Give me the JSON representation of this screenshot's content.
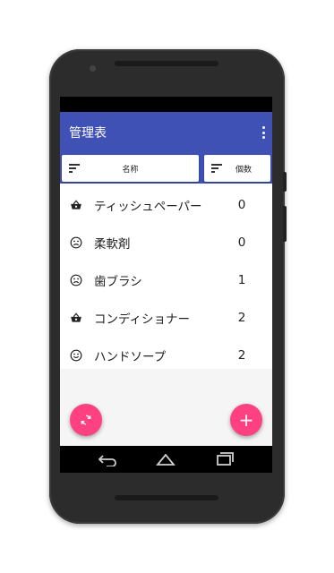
{
  "app": {
    "title": "管理表"
  },
  "sort_buttons": {
    "name_label": "名称",
    "count_label": "個数"
  },
  "items": [
    {
      "name": "ティッシュペーパー",
      "count": "0",
      "icon": "shopping-basket-icon"
    },
    {
      "name": "柔軟剤",
      "count": "0",
      "icon": "sad-face-icon"
    },
    {
      "name": "歯ブラシ",
      "count": "1",
      "icon": "sad-face-icon"
    },
    {
      "name": "コンディショナー",
      "count": "2",
      "icon": "shopping-basket-icon"
    },
    {
      "name": "ハンドソープ",
      "count": "2",
      "icon": "smile-face-icon"
    }
  ],
  "fabs": {
    "left_icon": "refresh-icon",
    "right_icon": "add-icon",
    "right_glyph": "+"
  },
  "colors": {
    "primary": "#3f51b5",
    "accent": "#ff4081",
    "list_bg": "#ffffff",
    "empty_bg": "#f5f5f5"
  }
}
